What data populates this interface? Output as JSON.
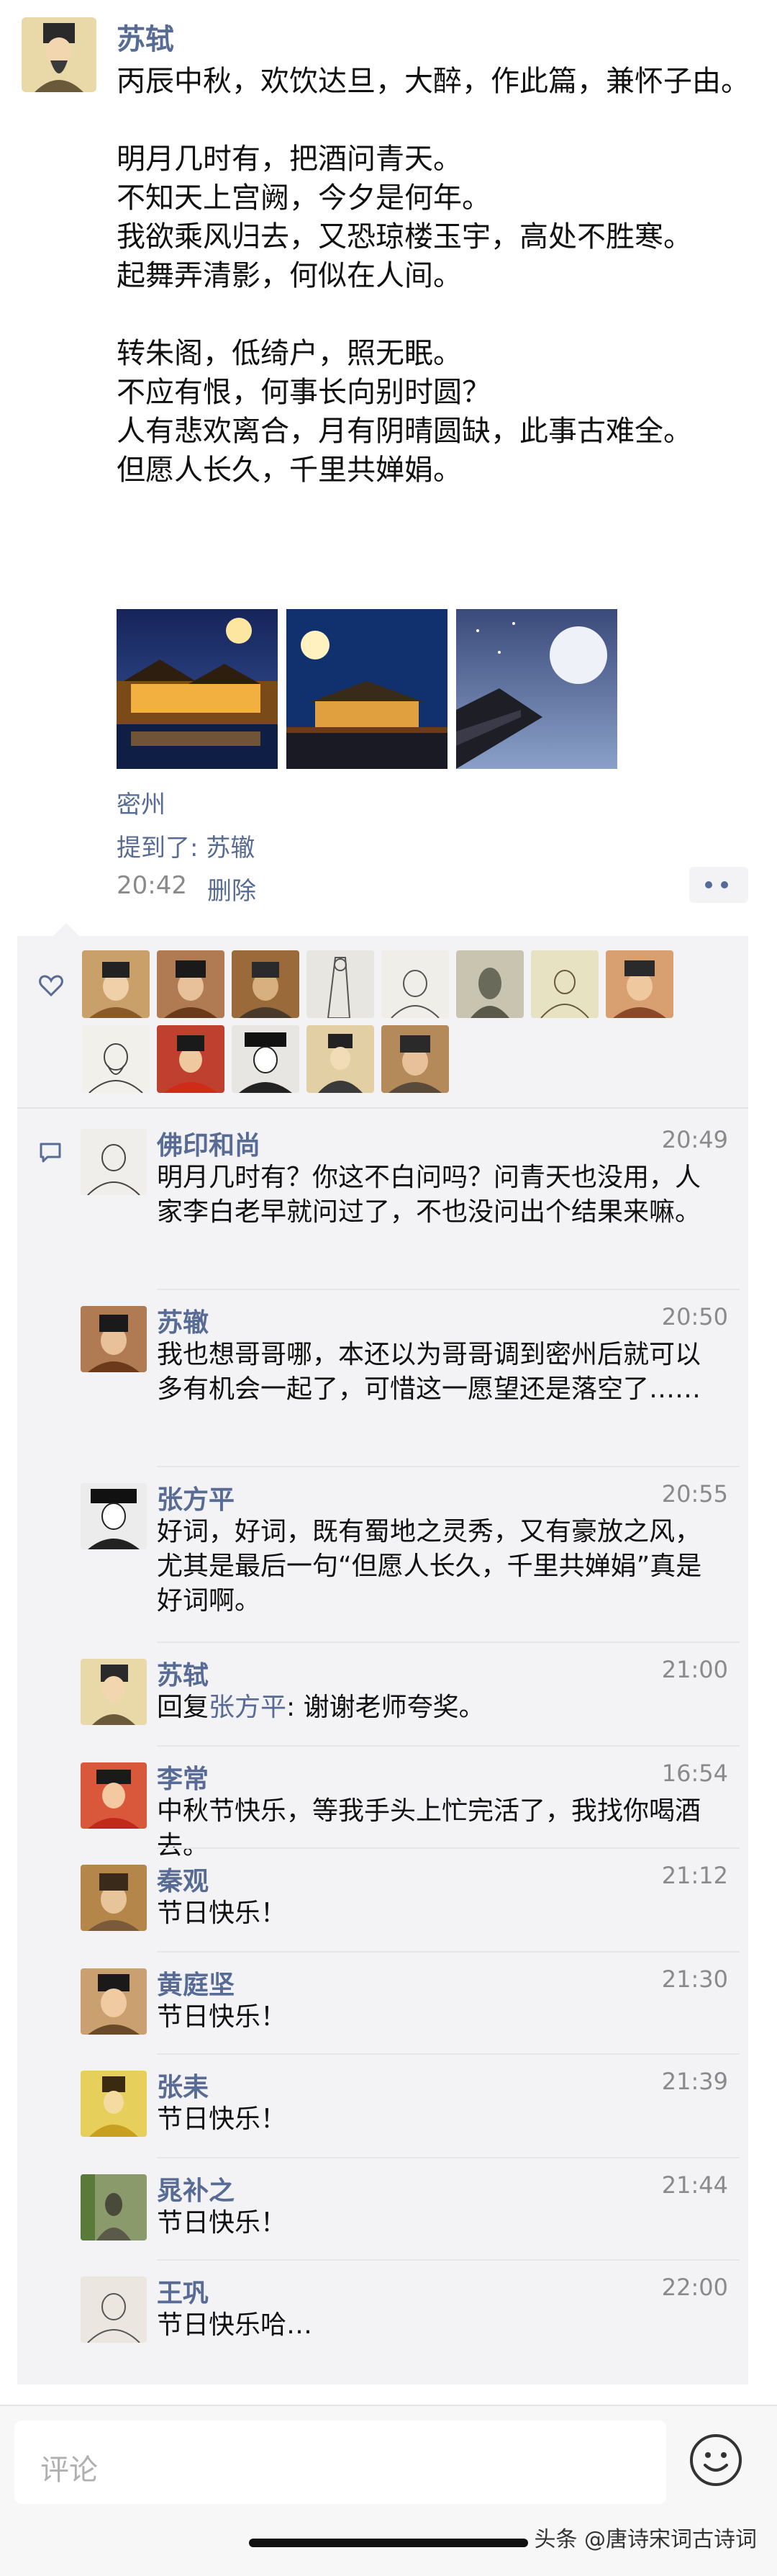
{
  "post": {
    "author": "苏轼",
    "text": "丙辰中秋，欢饮达旦，大醉，作此篇，兼怀子由。\n\n明月几时有，把酒问青天。\n不知天上宫阙，今夕是何年。\n我欲乘风归去，又恐琼楼玉宇，高处不胜寒。\n起舞弄清影，何似在人间。\n\n转朱阁，低绮户，照无眠。\n不应有恨，何事长向别时圆？\n人有悲欢离合，月有阴晴圆缺，此事古难全。\n但愿人长久，千里共婵娟。",
    "location": "密州",
    "mention": "提到了: 苏辙",
    "time": "20:42",
    "delete_label": "删除",
    "photos": [
      {
        "name": "pavilion-moon-photo"
      },
      {
        "name": "palace-moon-photo"
      },
      {
        "name": "rooftop-moon-photo"
      }
    ]
  },
  "likes": {
    "icon": "heart-icon",
    "avatars": [
      {
        "name": "like-avatar-1",
        "color": "#c9a06a"
      },
      {
        "name": "like-avatar-2",
        "color": "#b07a52"
      },
      {
        "name": "like-avatar-3",
        "color": "#9a6a3a"
      },
      {
        "name": "like-avatar-4",
        "color": "#e8e6e0"
      },
      {
        "name": "like-avatar-5",
        "color": "#f0eee8"
      },
      {
        "name": "like-avatar-6",
        "color": "#c8c4b0"
      },
      {
        "name": "like-avatar-7",
        "color": "#e6e2c2"
      },
      {
        "name": "like-avatar-8",
        "color": "#d8a070"
      },
      {
        "name": "like-avatar-9",
        "color": "#f2f0ea"
      },
      {
        "name": "like-avatar-10",
        "color": "#c04030"
      },
      {
        "name": "like-avatar-11",
        "color": "#e8e6e2"
      },
      {
        "name": "like-avatar-12",
        "color": "#e2cfa4"
      },
      {
        "name": "like-avatar-13",
        "color": "#b48a5a"
      }
    ]
  },
  "comments": {
    "icon": "comment-icon",
    "items": [
      {
        "name": "佛印和尚",
        "time": "20:49",
        "text": "明月几时有？你这不白问吗？问青天也没用，人家李白老早就问过了，不也没问出个结果来嘛。",
        "avatar_color": "#f0eeea"
      },
      {
        "name": "苏辙",
        "time": "20:50",
        "text": "我也想哥哥哪，本还以为哥哥调到密州后就可以多有机会一起了，可惜这一愿望还是落空了……",
        "avatar_color": "#b07a52"
      },
      {
        "name": "张方平",
        "time": "20:55",
        "text": "好词，好词，既有蜀地之灵秀，又有豪放之风，尤其是最后一句“但愿人长久，千里共婵娟”真是好词啊。",
        "avatar_color": "#ececec"
      },
      {
        "name": "苏轼",
        "time": "21:00",
        "reply_prefix": "回复",
        "reply_to": "张方平",
        "text": ": 谢谢老师夸奖。",
        "avatar_color": "#e9d9a8"
      },
      {
        "name": "李常",
        "time": "16:54",
        "text": "中秋节快乐，等我手头上忙完活了，我找你喝酒去。",
        "avatar_color": "#d9573a"
      },
      {
        "name": "秦观",
        "time": "21:12",
        "text": "节日快乐！",
        "avatar_color": "#b4864a"
      },
      {
        "name": "黄庭坚",
        "time": "21:30",
        "text": "节日快乐！",
        "avatar_color": "#caa070"
      },
      {
        "name": "张耒",
        "time": "21:39",
        "text": "节日快乐！",
        "avatar_color": "#e6cf5a"
      },
      {
        "name": "晁补之",
        "time": "21:44",
        "text": "节日快乐！",
        "avatar_color": "#8a9a6a"
      },
      {
        "name": "王巩",
        "time": "22:00",
        "text": "节日快乐哈…",
        "avatar_color": "#ebe7e0"
      }
    ]
  },
  "input": {
    "placeholder": "评论",
    "emoji_icon": "emoji-smile-icon"
  },
  "watermark": "头条 @唐诗宋词古诗词"
}
